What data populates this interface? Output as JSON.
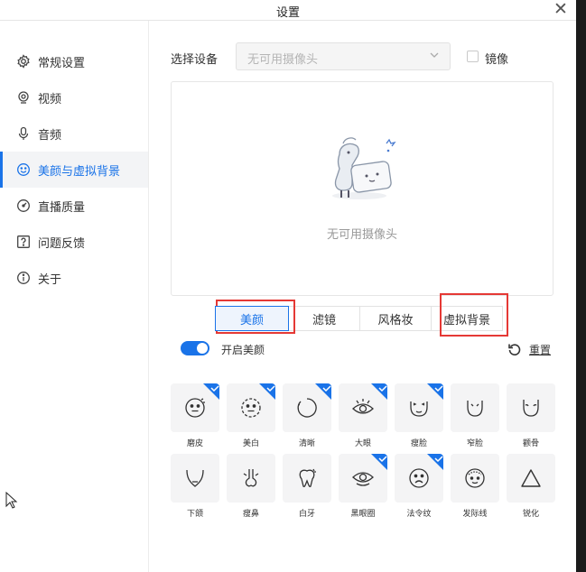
{
  "window": {
    "title": "设置"
  },
  "sidebar": {
    "items": [
      {
        "label": "常规设置",
        "icon": "gear-icon",
        "active": false
      },
      {
        "label": "视频",
        "icon": "camera-icon",
        "active": false
      },
      {
        "label": "音频",
        "icon": "microphone-icon",
        "active": false
      },
      {
        "label": "美颜与虚拟背景",
        "icon": "smile-icon",
        "active": true
      },
      {
        "label": "直播质量",
        "icon": "gauge-icon",
        "active": false
      },
      {
        "label": "问题反馈",
        "icon": "question-icon",
        "active": false
      },
      {
        "label": "关于",
        "icon": "info-icon",
        "active": false
      }
    ]
  },
  "device": {
    "label": "选择设备",
    "selected": "无可用摄像头",
    "mirror_label": "镜像"
  },
  "preview": {
    "empty_text": "无可用摄像头"
  },
  "tabs": [
    {
      "label": "美颜",
      "active": true
    },
    {
      "label": "滤镜",
      "active": false
    },
    {
      "label": "风格妆",
      "active": false
    },
    {
      "label": "虚拟背景",
      "active": false
    }
  ],
  "beauty": {
    "toggle_label": "开启美颜",
    "toggle_on": true,
    "reset_label": "重置",
    "items": [
      {
        "label": "磨皮",
        "icon": "smooth-skin-icon",
        "checked": true
      },
      {
        "label": "美白",
        "icon": "whiten-icon",
        "checked": true
      },
      {
        "label": "清晰",
        "icon": "sharpen-circle-icon",
        "checked": true
      },
      {
        "label": "大眼",
        "icon": "big-eye-icon",
        "checked": true
      },
      {
        "label": "瘦脸",
        "icon": "slim-face-icon",
        "checked": true
      },
      {
        "label": "窄脸",
        "icon": "narrow-face-icon",
        "checked": false
      },
      {
        "label": "颧骨",
        "icon": "cheekbone-icon",
        "checked": false
      },
      {
        "label": "下颌",
        "icon": "jaw-icon",
        "checked": false
      },
      {
        "label": "瘦鼻",
        "icon": "nose-icon",
        "checked": false
      },
      {
        "label": "白牙",
        "icon": "tooth-icon",
        "checked": false
      },
      {
        "label": "黑眼圈",
        "icon": "dark-circle-icon",
        "checked": true
      },
      {
        "label": "法令纹",
        "icon": "nasolabial-icon",
        "checked": true
      },
      {
        "label": "发际线",
        "icon": "hairline-icon",
        "checked": false
      },
      {
        "label": "锐化",
        "icon": "triangle-icon",
        "checked": false
      }
    ]
  },
  "colors": {
    "accent": "#1a73e8",
    "highlight_box": "#e53935"
  }
}
